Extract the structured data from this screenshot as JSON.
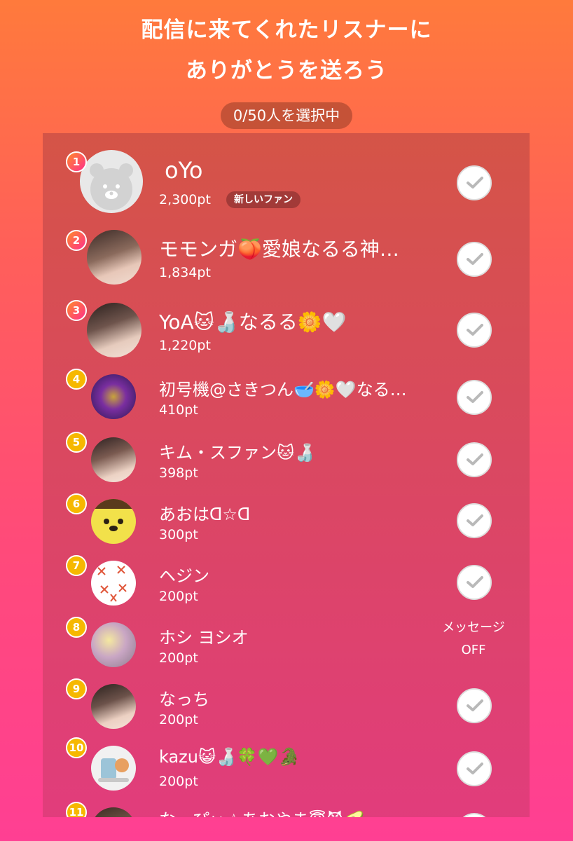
{
  "header": {
    "title_line1": "配信に来てくれたリスナーに",
    "title_line2": "ありがとうを送ろう",
    "selection_counter": "0/50人を選択中"
  },
  "listeners": [
    {
      "rank": "1",
      "name": "oYo",
      "points": "2,300pt",
      "badge": "新しいファン",
      "select": "check"
    },
    {
      "rank": "2",
      "name": "モモンガ🍑愛娘なるる神…",
      "points": "1,834pt",
      "select": "check"
    },
    {
      "rank": "3",
      "name": "YoA🐱🍶なるる🌼🤍",
      "points": "1,220pt",
      "select": "check"
    },
    {
      "rank": "4",
      "name": "初号機@さきつん🥣🌼🤍なる…",
      "points": "410pt",
      "select": "check"
    },
    {
      "rank": "5",
      "name": "キム・スファン🐱🍶",
      "points": "398pt",
      "select": "check"
    },
    {
      "rank": "6",
      "name": "あおはᗡ☆ᗡ",
      "points": "300pt",
      "select": "check"
    },
    {
      "rank": "7",
      "name": "ヘジン",
      "points": "200pt",
      "select": "check"
    },
    {
      "rank": "8",
      "name": "ホシ ヨシオ",
      "points": "200pt",
      "select": "message_off",
      "message_off_line1": "メッセージ",
      "message_off_line2": "OFF"
    },
    {
      "rank": "9",
      "name": "なっち",
      "points": "200pt",
      "select": "check"
    },
    {
      "rank": "10",
      "name": "kazu😺🍶🍀💚🐊",
      "points": "200pt",
      "select": "check"
    },
    {
      "rank": "11",
      "name": "なっぴぃ☆あおやま😇😈🥑",
      "points": "",
      "select": "check"
    }
  ],
  "colors": {
    "rank_top3_gradient": [
      "#ff8a2a",
      "#ff2f8c"
    ],
    "rank_other": "#f6b800",
    "check_mark": "#b9b9b9"
  },
  "icons": {
    "check": "check-icon",
    "default_avatar": "bear-avatar-icon"
  }
}
